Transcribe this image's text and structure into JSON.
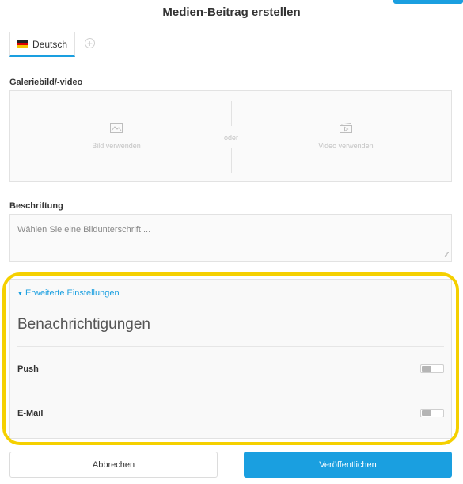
{
  "title": "Medien-Beitrag erstellen",
  "tabs": {
    "active_label": "Deutsch",
    "add_symbol": "+"
  },
  "gallery": {
    "label": "Galeriebild/-video",
    "image_option": "Bild verwenden",
    "or_text": "oder",
    "video_option": "Video verwenden"
  },
  "caption": {
    "label": "Beschriftung",
    "placeholder": "Wählen Sie eine Bildunterschrift ..."
  },
  "advanced": {
    "link_label": "Erweiterte Einstellungen",
    "notifications_title": "Benachrichtigungen",
    "push_label": "Push",
    "email_label": "E-Mail",
    "push_enabled": false,
    "email_enabled": false
  },
  "footer": {
    "cancel_label": "Abbrechen",
    "publish_label": "Veröffentlichen"
  },
  "colors": {
    "accent": "#1a9fe0",
    "highlight": "#f5d000"
  }
}
